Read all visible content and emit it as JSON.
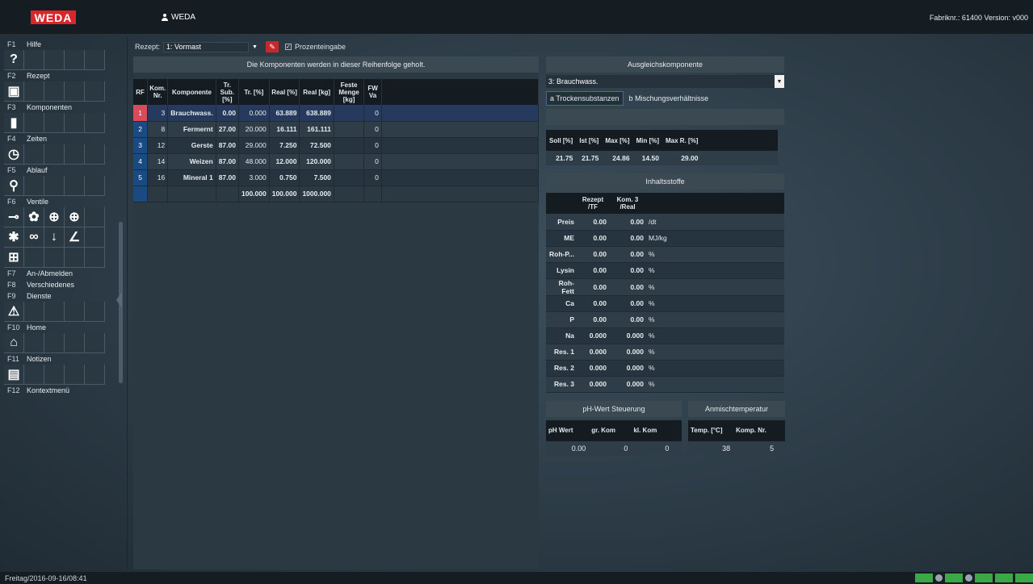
{
  "header": {
    "logo": "WEDA",
    "user": "WEDA",
    "version": "Fabriknr.: 61400   Version: v000"
  },
  "nav": [
    {
      "key": "F1",
      "label": "Hilfe"
    },
    {
      "key": "F2",
      "label": "Rezept"
    },
    {
      "key": "F3",
      "label": "Komponenten"
    },
    {
      "key": "F4",
      "label": "Zeiten"
    },
    {
      "key": "F5",
      "label": "Ablauf"
    },
    {
      "key": "F6",
      "label": "Ventile"
    },
    {
      "key": "F7",
      "label": "An-/Abmelden"
    },
    {
      "key": "F8",
      "label": "Verschiedenes"
    },
    {
      "key": "F9",
      "label": "Dienste"
    },
    {
      "key": "F10",
      "label": "Home"
    },
    {
      "key": "F11",
      "label": "Notizen"
    },
    {
      "key": "F12",
      "label": "Kontextmenü"
    }
  ],
  "rezept": {
    "label": "Rezept:",
    "value": "1: Vormast",
    "checkbox_label": "Prozenteingabe"
  },
  "components": {
    "title": "Die Komponenten werden in dieser Reihenfolge geholt.",
    "headers": [
      "RF",
      "Kom. Nr.",
      "Komponente",
      "Tr. Sub. [%]",
      "Tr. [%]",
      "Real [%]",
      "Real [kg]",
      "Feste Menge [kg]",
      "FW Va"
    ],
    "rows": [
      {
        "rf": "1",
        "nr": "3",
        "name": "Brauchwass.",
        "trsub": "0.00",
        "tr": "0.000",
        "realp": "63.889",
        "realkg": "638.889",
        "fest": "",
        "fw": "0"
      },
      {
        "rf": "2",
        "nr": "8",
        "name": "Fermernt",
        "trsub": "27.00",
        "tr": "20.000",
        "realp": "16.111",
        "realkg": "161.111",
        "fest": "",
        "fw": "0"
      },
      {
        "rf": "3",
        "nr": "12",
        "name": "Gerste",
        "trsub": "87.00",
        "tr": "29.000",
        "realp": "7.250",
        "realkg": "72.500",
        "fest": "",
        "fw": "0"
      },
      {
        "rf": "4",
        "nr": "14",
        "name": "Weizen",
        "trsub": "87.00",
        "tr": "48.000",
        "realp": "12.000",
        "realkg": "120.000",
        "fest": "",
        "fw": "0"
      },
      {
        "rf": "5",
        "nr": "16",
        "name": "Mineral 1",
        "trsub": "87.00",
        "tr": "3.000",
        "realp": "0.750",
        "realkg": "7.500",
        "fest": "",
        "fw": "0"
      }
    ],
    "sum": {
      "tr": "100.000",
      "realp": "100.000",
      "realkg": "1000.000"
    }
  },
  "ausgleich": {
    "title": "Ausgleichskomponente",
    "value": "3: Brauchwass.",
    "tab_a": "a Trockensubstanzen",
    "tab_b": "b Mischungsverhältnisse",
    "headers": [
      "Soll [%]",
      "Ist [%]",
      "Max [%]",
      "Min [%]",
      "Max R. [%]"
    ],
    "values": [
      "21.75",
      "21.75",
      "24.86",
      "14.50",
      "29.00"
    ]
  },
  "inhaltsstoffe": {
    "title": "Inhaltsstoffe",
    "headers": [
      "Rezept /TF",
      "Kom. 3 /Real"
    ],
    "rows": [
      {
        "name": "Preis",
        "a": "0.00",
        "b": "0.00",
        "unit": "/dt"
      },
      {
        "name": "ME",
        "a": "0.00",
        "b": "0.00",
        "unit": "MJ/kg"
      },
      {
        "name": "Roh-P...",
        "a": "0.00",
        "b": "0.00",
        "unit": "%"
      },
      {
        "name": "Lysin",
        "a": "0.00",
        "b": "0.00",
        "unit": "%"
      },
      {
        "name": "Roh-Fett",
        "a": "0.00",
        "b": "0.00",
        "unit": "%"
      },
      {
        "name": "Ca",
        "a": "0.00",
        "b": "0.00",
        "unit": "%"
      },
      {
        "name": "P",
        "a": "0.00",
        "b": "0.00",
        "unit": "%"
      },
      {
        "name": "Na",
        "a": "0.000",
        "b": "0.000",
        "unit": "%"
      },
      {
        "name": "Res. 1",
        "a": "0.000",
        "b": "0.000",
        "unit": "%"
      },
      {
        "name": "Res. 2",
        "a": "0.000",
        "b": "0.000",
        "unit": "%"
      },
      {
        "name": "Res. 3",
        "a": "0.000",
        "b": "0.000",
        "unit": "%"
      }
    ]
  },
  "ph": {
    "title": "pH-Wert Steuerung",
    "headers": [
      "pH Wert",
      "gr. Kom",
      "kl. Kom"
    ],
    "values": [
      "0.00",
      "0",
      "0"
    ]
  },
  "anmisch": {
    "title": "Anmischtemperatur",
    "headers": [
      "Temp. [°C]",
      "Komp. Nr."
    ],
    "values": [
      "38",
      "5"
    ]
  },
  "status": {
    "datetime": "Freitag/2016-09-16/08:41"
  }
}
